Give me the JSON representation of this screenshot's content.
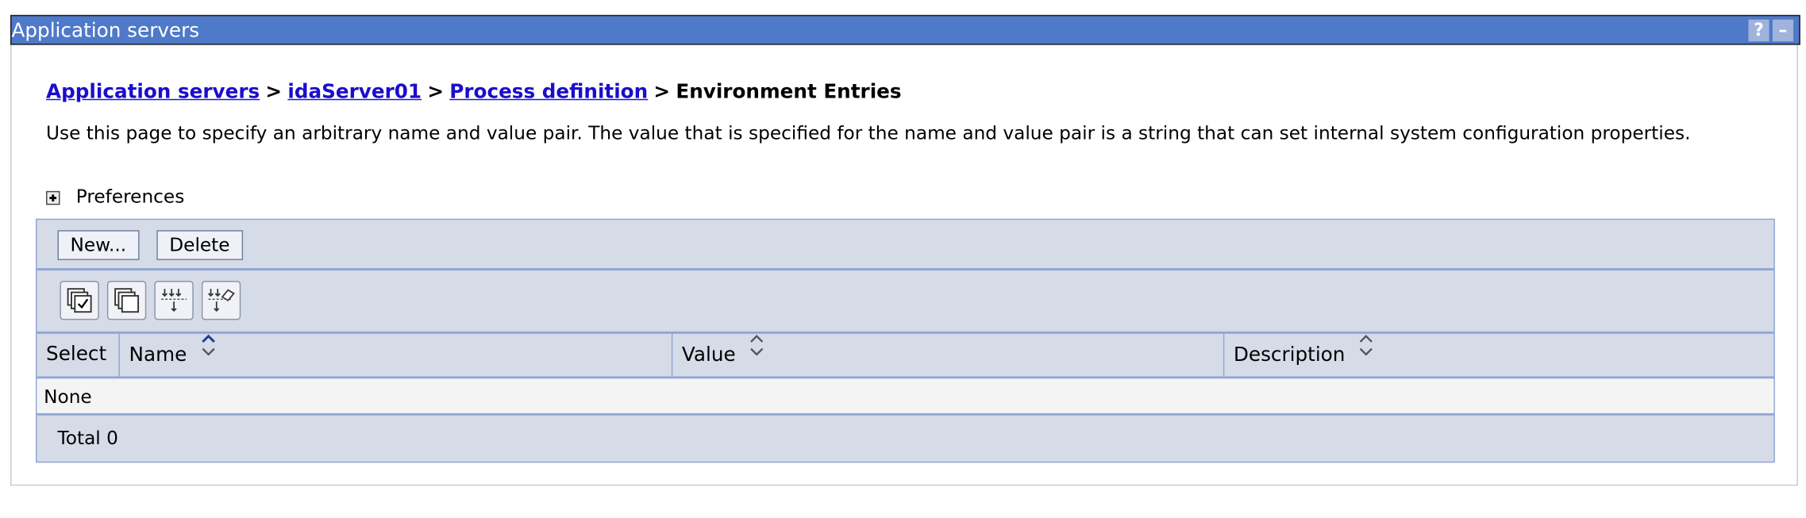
{
  "window": {
    "title": "Application servers",
    "help_label": "?",
    "minimize_label": "–"
  },
  "breadcrumb": {
    "items": [
      {
        "label": "Application servers",
        "link": true
      },
      {
        "label": "idaServer01",
        "link": true
      },
      {
        "label": "Process definition",
        "link": true
      },
      {
        "label": "Environment Entries",
        "link": false
      }
    ],
    "separator": ">"
  },
  "description": "Use this page to specify an arbitrary name and value pair. The value that is specified for the name and value pair is a string that can set internal system configuration properties.",
  "preferences": {
    "label": "Preferences",
    "icon": "expand-plus-icon"
  },
  "toolbar": {
    "new_label": "New...",
    "delete_label": "Delete"
  },
  "icon_toolbar": {
    "icons": [
      "select-all-icon",
      "deselect-all-icon",
      "show-filter-icon",
      "clear-filter-icon"
    ]
  },
  "table": {
    "columns": [
      {
        "label": "Select",
        "sortable": false
      },
      {
        "label": "Name",
        "sortable": true,
        "sort_state": "ascending"
      },
      {
        "label": "Value",
        "sortable": true
      },
      {
        "label": "Description",
        "sortable": true
      }
    ],
    "empty_text": "None",
    "total_label": "Total 0"
  },
  "colors": {
    "titlebar": "#4f79c9",
    "table_bg": "#d6dbe8",
    "table_border": "#8fa6d3",
    "link": "#1a0dcc"
  }
}
